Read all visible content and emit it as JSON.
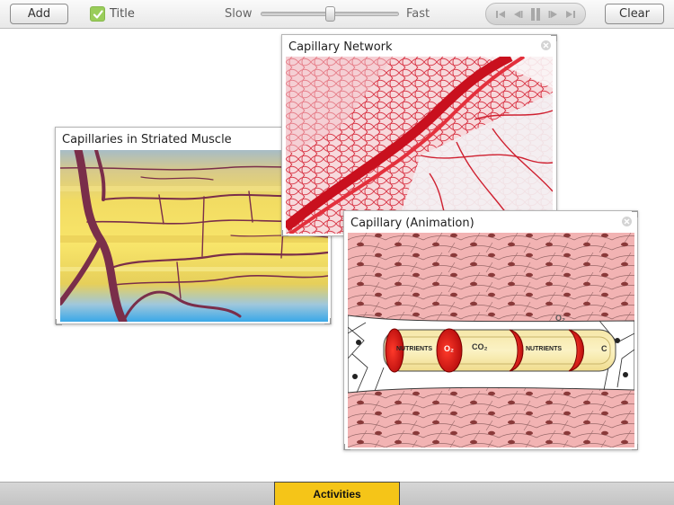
{
  "toolbar": {
    "add_label": "Add",
    "title_toggle": {
      "label": "Title",
      "checked": true,
      "color": "#9acd5a"
    },
    "speed": {
      "slow_label": "Slow",
      "fast_label": "Fast",
      "value": 0.5
    },
    "playback_icons": [
      "skip-to-start-icon",
      "step-back-icon",
      "pause-icon",
      "step-forward-icon",
      "skip-to-end-icon"
    ],
    "clear_label": "Clear"
  },
  "cards": [
    {
      "title": "Capillaries in Striated Muscle"
    },
    {
      "title": "Capillary Network"
    },
    {
      "title": "Capillary (Animation)",
      "labels": {
        "nutrients_1": "NUTRIENTS",
        "o2_1": "O₂",
        "co2_1": "CO₂",
        "nutrients_2": "NUTRIENTS",
        "o2_top": "O₂",
        "co_right": "C"
      }
    }
  ],
  "bottom": {
    "activities_label": "Activities",
    "accent": "#f5c518"
  }
}
